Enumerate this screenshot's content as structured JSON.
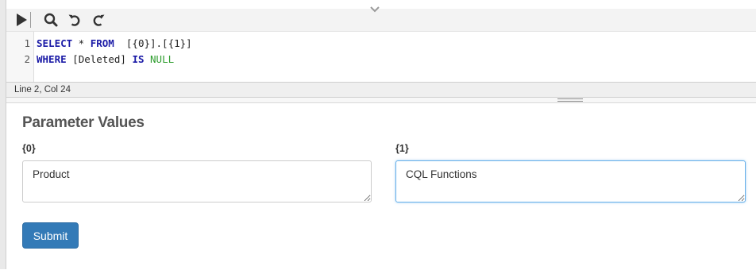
{
  "toolbar": {
    "buttons": [
      {
        "name": "run",
        "icon": "play-icon"
      },
      {
        "name": "search",
        "icon": "search-icon"
      },
      {
        "name": "undo",
        "icon": "undo-icon"
      },
      {
        "name": "redo",
        "icon": "redo-icon"
      }
    ]
  },
  "editor": {
    "line_numbers": [
      "1",
      "2"
    ],
    "line1": {
      "kw1": "SELECT",
      "op": " * ",
      "kw2": "FROM",
      "rest": "  [{0}].[{1}]"
    },
    "line2": {
      "kw1": "WHERE",
      "mid": " [Deleted] ",
      "kw2": "IS",
      "sp": " ",
      "null": "NULL"
    },
    "colors": {
      "keyword": "#1a1aa6",
      "null": "#2e9d2e"
    }
  },
  "status": {
    "text": "Line 2, Col 24"
  },
  "panel": {
    "title": "Parameter Values",
    "params": [
      {
        "label": "{0}",
        "value": "Product"
      },
      {
        "label": "{1}",
        "value": "CQL Functions"
      }
    ],
    "submit_label": "Submit",
    "accent": "#337ab7"
  }
}
